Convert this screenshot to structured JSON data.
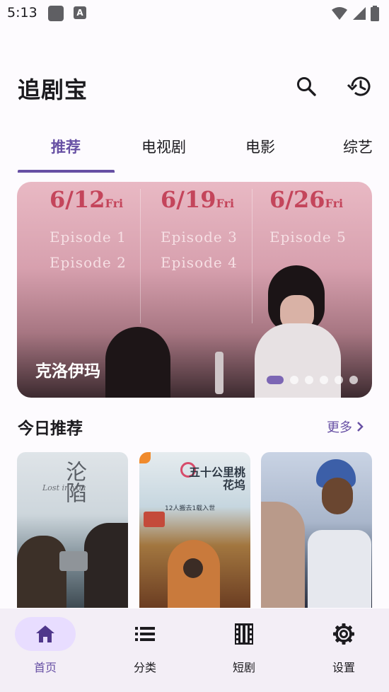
{
  "status_bar": {
    "time": "5:13",
    "a_icon": "A"
  },
  "header": {
    "title": "追剧宝",
    "search_icon": "search-icon",
    "history_icon": "history-icon"
  },
  "tabs": [
    {
      "label": "推荐",
      "active": true
    },
    {
      "label": "电视剧",
      "active": false
    },
    {
      "label": "电影",
      "active": false
    },
    {
      "label": "综艺",
      "active": false
    }
  ],
  "banner": {
    "title": "克洛伊玛",
    "schedule": [
      {
        "date": "6/12",
        "day": "Fri",
        "episodes": [
          "Episode 1",
          "Episode 2"
        ]
      },
      {
        "date": "6/19",
        "day": "Fri",
        "episodes": [
          "Episode 3",
          "Episode 4"
        ]
      },
      {
        "date": "6/26",
        "day": "Fri",
        "episodes": [
          "Episode 5"
        ]
      }
    ],
    "slide_count": 6,
    "active_slide": 0
  },
  "section": {
    "title": "今日推荐",
    "more_label": "更多"
  },
  "posters": [
    {
      "text_main": "沦陷",
      "text_sub": "Lost in you"
    },
    {
      "text_main": "五十公里桃花坞",
      "text_sub": "12人搬去1载入世"
    },
    {
      "text_main": "",
      "text_sub": ""
    }
  ],
  "bottom_nav": [
    {
      "label": "首页",
      "icon": "home-icon",
      "active": true
    },
    {
      "label": "分类",
      "icon": "list-icon",
      "active": false
    },
    {
      "label": "短剧",
      "icon": "film-icon",
      "active": false
    },
    {
      "label": "设置",
      "icon": "gear-icon",
      "active": false
    }
  ],
  "colors": {
    "accent": "#6750a4",
    "nav_bg": "#f3eef6",
    "pill": "#e8ddff"
  }
}
